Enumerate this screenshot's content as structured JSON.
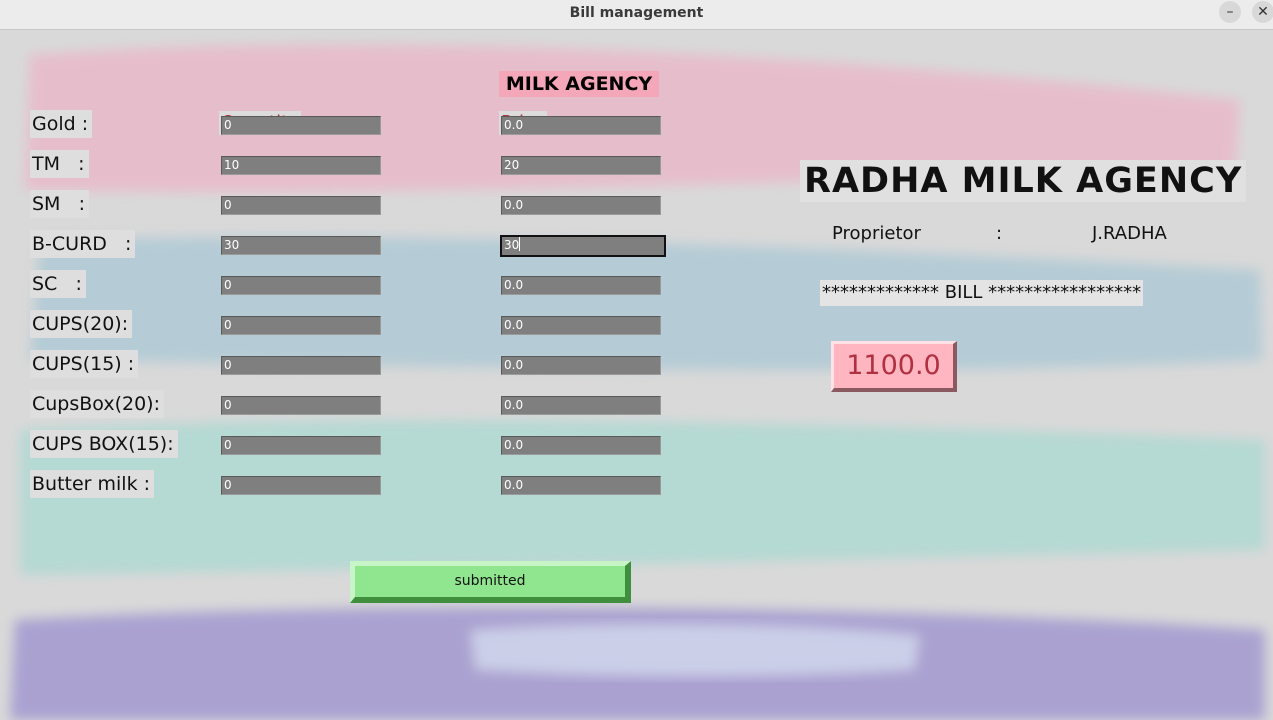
{
  "window": {
    "title": "Bill management",
    "minimize_glyph": "–",
    "close_glyph": "✕"
  },
  "header": {
    "title": "MILK AGENCY",
    "quantity_label": "Quantity",
    "price_label": "Price"
  },
  "rows": [
    {
      "label": "Gold :",
      "quantity": "0",
      "price": "0.0"
    },
    {
      "label": "TM   :",
      "quantity": "10",
      "price": "20"
    },
    {
      "label": "SM   :",
      "quantity": "0",
      "price": "0.0"
    },
    {
      "label": "B-CURD   :",
      "quantity": "30",
      "price": "30"
    },
    {
      "label": "SC   :",
      "quantity": "0",
      "price": "0.0"
    },
    {
      "label": "CUPS(20):",
      "quantity": "0",
      "price": "0.0"
    },
    {
      "label": "CUPS(15) :",
      "quantity": "0",
      "price": "0.0"
    },
    {
      "label": "CupsBox(20):",
      "quantity": "0",
      "price": "0.0"
    },
    {
      "label": "CUPS BOX(15):",
      "quantity": "0",
      "price": "0.0"
    },
    {
      "label": "Butter milk :",
      "quantity": "0",
      "price": "0.0"
    }
  ],
  "submit_label": "submitted",
  "agency": {
    "name": "RADHA MILK AGENCY",
    "proprietor_label": "Proprietor",
    "separator": ":",
    "proprietor_name": "J.RADHA",
    "bill_banner": "************* BILL *****************",
    "total": "1100.0"
  },
  "colors": {
    "heading_bg": "#f4a7b9",
    "total_bg": "#ffb6c1",
    "total_text": "#b03040",
    "button_bg": "#8fe68f"
  }
}
